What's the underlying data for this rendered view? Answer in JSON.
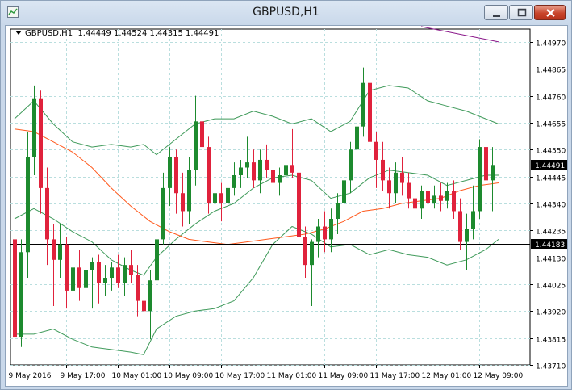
{
  "window": {
    "title": "GBPUSD,H1",
    "icons": {
      "app": "chart-app-icon",
      "minimize": "minimize-icon",
      "maximize": "maximize-icon",
      "close": "close-icon"
    }
  },
  "chart_info": {
    "symbol": "GBPUSD,H1",
    "ohlc": "1.44449 1.44524 1.44315 1.44491"
  },
  "colors": {
    "bull": "#1d8a2e",
    "bear": "#e0223c",
    "bands": "#3f9a5a",
    "ma": "#ff5a1e",
    "trendline": "#8b1a8b",
    "grid": "#b9dede",
    "bid_line": "#000000",
    "price_label": "#000000"
  },
  "price_labels": {
    "current": "1.44491",
    "hline": "1.44183"
  },
  "chart_data": {
    "type": "candlestick",
    "symbol": "GBPUSD",
    "timeframe": "H1",
    "ylim": [
      1.4371,
      1.4502
    ],
    "y_ticks": [
      "1.44970",
      "1.44865",
      "1.44760",
      "1.44655",
      "1.44550",
      "1.44445",
      "1.44340",
      "1.44235",
      "1.44130",
      "1.44025",
      "1.43920",
      "1.43815",
      "1.43710"
    ],
    "x_ticks": [
      {
        "label": "9 May 2016",
        "bar": 0
      },
      {
        "label": "9 May 17:00",
        "bar": 8
      },
      {
        "label": "10 May 01:00",
        "bar": 16
      },
      {
        "label": "10 May 09:00",
        "bar": 24
      },
      {
        "label": "10 May 17:00",
        "bar": 32
      },
      {
        "label": "11 May 01:00",
        "bar": 40
      },
      {
        "label": "11 May 09:00",
        "bar": 48
      },
      {
        "label": "11 May 17:00",
        "bar": 56
      },
      {
        "label": "12 May 01:00",
        "bar": 64
      },
      {
        "label": "12 May 09:00",
        "bar": 72
      }
    ],
    "candles": [
      [
        1.442,
        1.4422,
        1.4374,
        1.4382
      ],
      [
        1.4382,
        1.442,
        1.4378,
        1.4415
      ],
      [
        1.4415,
        1.4462,
        1.4405,
        1.4452
      ],
      [
        1.4452,
        1.448,
        1.4445,
        1.4475
      ],
      [
        1.4475,
        1.4478,
        1.443,
        1.444
      ],
      [
        1.444,
        1.4448,
        1.441,
        1.442
      ],
      [
        1.442,
        1.4426,
        1.4394,
        1.4412
      ],
      [
        1.4412,
        1.4426,
        1.4405,
        1.4418
      ],
      [
        1.4418,
        1.4421,
        1.4393,
        1.44
      ],
      [
        1.44,
        1.4412,
        1.4391,
        1.4409
      ],
      [
        1.4409,
        1.4416,
        1.4396,
        1.4401
      ],
      [
        1.4401,
        1.4412,
        1.4389,
        1.4408
      ],
      [
        1.4408,
        1.4413,
        1.4393,
        1.4411
      ],
      [
        1.4411,
        1.4414,
        1.4395,
        1.4403
      ],
      [
        1.4403,
        1.441,
        1.4398,
        1.4405
      ],
      [
        1.4405,
        1.4411,
        1.44,
        1.4409
      ],
      [
        1.4409,
        1.4414,
        1.4401,
        1.4403
      ],
      [
        1.4403,
        1.4413,
        1.4398,
        1.441
      ],
      [
        1.441,
        1.4416,
        1.4403,
        1.4406
      ],
      [
        1.4406,
        1.441,
        1.439,
        1.4396
      ],
      [
        1.4396,
        1.4401,
        1.4386,
        1.4392
      ],
      [
        1.4392,
        1.4408,
        1.4381,
        1.4404
      ],
      [
        1.4404,
        1.4425,
        1.4403,
        1.442
      ],
      [
        1.442,
        1.4446,
        1.4418,
        1.444
      ],
      [
        1.444,
        1.4456,
        1.4433,
        1.4452
      ],
      [
        1.4452,
        1.4455,
        1.443,
        1.4438
      ],
      [
        1.4438,
        1.4446,
        1.4425,
        1.4431
      ],
      [
        1.4431,
        1.4452,
        1.4426,
        1.4447
      ],
      [
        1.4447,
        1.4476,
        1.4441,
        1.4466
      ],
      [
        1.4466,
        1.447,
        1.4448,
        1.4456
      ],
      [
        1.4456,
        1.446,
        1.443,
        1.4434
      ],
      [
        1.4434,
        1.444,
        1.4427,
        1.4438
      ],
      [
        1.4438,
        1.4442,
        1.4427,
        1.4434
      ],
      [
        1.4434,
        1.4446,
        1.4428,
        1.444
      ],
      [
        1.444,
        1.445,
        1.4437,
        1.4445
      ],
      [
        1.4445,
        1.4451,
        1.444,
        1.4448
      ],
      [
        1.4448,
        1.446,
        1.4444,
        1.445
      ],
      [
        1.445,
        1.4455,
        1.444,
        1.4443
      ],
      [
        1.4443,
        1.4455,
        1.4438,
        1.4451
      ],
      [
        1.4451,
        1.4457,
        1.4444,
        1.4447
      ],
      [
        1.4447,
        1.445,
        1.4435,
        1.4442
      ],
      [
        1.4442,
        1.4448,
        1.4437,
        1.4445
      ],
      [
        1.4445,
        1.446,
        1.444,
        1.4449
      ],
      [
        1.4449,
        1.4463,
        1.4444,
        1.4446
      ],
      [
        1.4446,
        1.445,
        1.4415,
        1.4421
      ],
      [
        1.4421,
        1.4425,
        1.4405,
        1.441
      ],
      [
        1.441,
        1.442,
        1.4394,
        1.4419
      ],
      [
        1.4419,
        1.4428,
        1.4413,
        1.4425
      ],
      [
        1.4425,
        1.4431,
        1.4415,
        1.442
      ],
      [
        1.442,
        1.4432,
        1.4415,
        1.4428
      ],
      [
        1.4428,
        1.4438,
        1.4422,
        1.4434
      ],
      [
        1.4434,
        1.4447,
        1.4426,
        1.4443
      ],
      [
        1.4443,
        1.4458,
        1.4438,
        1.4455
      ],
      [
        1.4455,
        1.447,
        1.445,
        1.4464
      ],
      [
        1.4464,
        1.4487,
        1.446,
        1.4481
      ],
      [
        1.4481,
        1.4485,
        1.4452,
        1.4458
      ],
      [
        1.4458,
        1.4462,
        1.444,
        1.4451
      ],
      [
        1.4451,
        1.4458,
        1.4439,
        1.4443
      ],
      [
        1.4443,
        1.4448,
        1.4432,
        1.4438
      ],
      [
        1.4438,
        1.445,
        1.4434,
        1.4446
      ],
      [
        1.4446,
        1.4452,
        1.4437,
        1.4442
      ],
      [
        1.4442,
        1.4446,
        1.4432,
        1.4436
      ],
      [
        1.4436,
        1.4441,
        1.4428,
        1.4432
      ],
      [
        1.4432,
        1.4441,
        1.4428,
        1.4439
      ],
      [
        1.4439,
        1.4444,
        1.443,
        1.4434
      ],
      [
        1.4434,
        1.4441,
        1.4432,
        1.4437
      ],
      [
        1.4437,
        1.4442,
        1.4431,
        1.4435
      ],
      [
        1.4435,
        1.4442,
        1.4432,
        1.4439
      ],
      [
        1.4439,
        1.4443,
        1.4428,
        1.4431
      ],
      [
        1.4431,
        1.4436,
        1.4416,
        1.4419
      ],
      [
        1.4419,
        1.443,
        1.4408,
        1.4424
      ],
      [
        1.4424,
        1.4441,
        1.442,
        1.4431
      ],
      [
        1.4431,
        1.4459,
        1.4428,
        1.4456
      ],
      [
        1.4456,
        1.45,
        1.4438,
        1.4443
      ],
      [
        1.4443,
        1.4456,
        1.4431,
        1.4449
      ]
    ],
    "bollinger": {
      "upper": [
        [
          0,
          1.4467
        ],
        [
          3,
          1.4474
        ],
        [
          6,
          1.4465
        ],
        [
          9,
          1.4458
        ],
        [
          12,
          1.4456
        ],
        [
          15,
          1.4457
        ],
        [
          18,
          1.4456
        ],
        [
          20,
          1.4457
        ],
        [
          22,
          1.4453
        ],
        [
          25,
          1.4459
        ],
        [
          28,
          1.4465
        ],
        [
          31,
          1.4467
        ],
        [
          34,
          1.4467
        ],
        [
          37,
          1.447
        ],
        [
          40,
          1.4468
        ],
        [
          43,
          1.4465
        ],
        [
          46,
          1.4467
        ],
        [
          49,
          1.4462
        ],
        [
          52,
          1.4466
        ],
        [
          55,
          1.4478
        ],
        [
          58,
          1.448
        ],
        [
          61,
          1.4479
        ],
        [
          64,
          1.4474
        ],
        [
          67,
          1.4472
        ],
        [
          70,
          1.447
        ],
        [
          73,
          1.4467
        ],
        [
          75,
          1.4465
        ]
      ],
      "middle": [
        [
          0,
          1.4428
        ],
        [
          3,
          1.4432
        ],
        [
          6,
          1.4428
        ],
        [
          9,
          1.4423
        ],
        [
          12,
          1.4419
        ],
        [
          15,
          1.4412
        ],
        [
          18,
          1.4408
        ],
        [
          20,
          1.4406
        ],
        [
          22,
          1.4413
        ],
        [
          25,
          1.442
        ],
        [
          28,
          1.4426
        ],
        [
          31,
          1.4431
        ],
        [
          34,
          1.4434
        ],
        [
          37,
          1.444
        ],
        [
          40,
          1.4444
        ],
        [
          43,
          1.4445
        ],
        [
          46,
          1.4443
        ],
        [
          49,
          1.4436
        ],
        [
          52,
          1.4438
        ],
        [
          55,
          1.4444
        ],
        [
          58,
          1.4447
        ],
        [
          61,
          1.4446
        ],
        [
          64,
          1.4445
        ],
        [
          67,
          1.4441
        ],
        [
          70,
          1.4443
        ],
        [
          73,
          1.4445
        ],
        [
          75,
          1.4445
        ]
      ],
      "lower": [
        [
          0,
          1.4383
        ],
        [
          3,
          1.4383
        ],
        [
          6,
          1.4385
        ],
        [
          9,
          1.4381
        ],
        [
          12,
          1.4378
        ],
        [
          15,
          1.4377
        ],
        [
          18,
          1.4376
        ],
        [
          20,
          1.4375
        ],
        [
          22,
          1.4385
        ],
        [
          25,
          1.439
        ],
        [
          28,
          1.4392
        ],
        [
          31,
          1.4393
        ],
        [
          34,
          1.4396
        ],
        [
          37,
          1.4405
        ],
        [
          40,
          1.4418
        ],
        [
          43,
          1.4425
        ],
        [
          46,
          1.4422
        ],
        [
          49,
          1.4417
        ],
        [
          52,
          1.4418
        ],
        [
          55,
          1.4414
        ],
        [
          58,
          1.4416
        ],
        [
          61,
          1.4414
        ],
        [
          64,
          1.4413
        ],
        [
          67,
          1.441
        ],
        [
          70,
          1.4412
        ],
        [
          73,
          1.4416
        ],
        [
          75,
          1.442
        ]
      ]
    },
    "moving_average": [
      [
        0,
        1.4463
      ],
      [
        3,
        1.4462
      ],
      [
        6,
        1.4458
      ],
      [
        9,
        1.4454
      ],
      [
        12,
        1.4448
      ],
      [
        15,
        1.444
      ],
      [
        18,
        1.4433
      ],
      [
        21,
        1.4427
      ],
      [
        24,
        1.4423
      ],
      [
        27,
        1.442
      ],
      [
        30,
        1.4419
      ],
      [
        33,
        1.4418
      ],
      [
        36,
        1.4419
      ],
      [
        39,
        1.442
      ],
      [
        42,
        1.4421
      ],
      [
        45,
        1.4422
      ],
      [
        48,
        1.4424
      ],
      [
        51,
        1.4427
      ],
      [
        54,
        1.4431
      ],
      [
        57,
        1.4432
      ],
      [
        60,
        1.4434
      ],
      [
        63,
        1.4435
      ],
      [
        66,
        1.4436
      ],
      [
        69,
        1.4439
      ],
      [
        72,
        1.4441
      ],
      [
        75,
        1.4442
      ]
    ],
    "trendline": [
      [
        63,
        1.4503
      ],
      [
        75,
        1.4497
      ]
    ],
    "hline": 1.44183,
    "current_price": 1.44491
  }
}
